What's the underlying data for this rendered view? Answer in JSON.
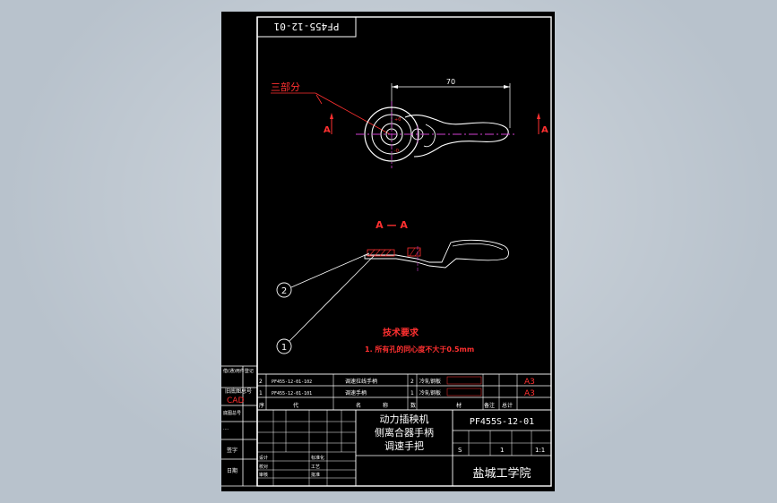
{
  "drawing_number_mirrored": "PF455-12-01",
  "view_top": {
    "part_callout": "三部分",
    "dimension": "70",
    "section_mark_left": "A",
    "section_mark_right": "A"
  },
  "view_section": {
    "title": "A — A",
    "balloon_1": "1",
    "balloon_2": "2"
  },
  "notes": {
    "heading": "技术要求",
    "item1": "1. 所有孔的同心度不大于0.5mm"
  },
  "bom": {
    "row2": {
      "no": "2",
      "code": "PF455-12-01-102",
      "name": "调速拉线手柄",
      "qty": "2",
      "material": "冷轧钢板",
      "format": "A3"
    },
    "row1": {
      "no": "1",
      "code": "PF455-12-01-101",
      "name": "调速手柄",
      "qty": "1",
      "material": "冷轧钢板",
      "format": "A3"
    },
    "header": {
      "no": "序",
      "code": "代",
      "name": "名",
      "name2": "称",
      "qty": "数",
      "material": "材",
      "remark": "备注",
      "format": "总计"
    }
  },
  "title_block": {
    "title_line1": "动力插秧机",
    "title_line2": "侧离合器手柄",
    "title_line3": "调速手把",
    "drawing_number": "PF455S-12-01",
    "scale": "1:1",
    "stage": "S",
    "sheet": "1",
    "school": "盐城工学院",
    "designer_label": "设计",
    "checker_label": "校对",
    "approve_label": "审核",
    "process_label": "工艺",
    "std_label": "标准化",
    "approve2_label": "批准"
  },
  "left_strip": {
    "label1": "借(通)用件登记",
    "label2": "旧底图总号",
    "label3": "CAD",
    "label4": "底图总号",
    "label5": "签字",
    "label6": "日期"
  }
}
